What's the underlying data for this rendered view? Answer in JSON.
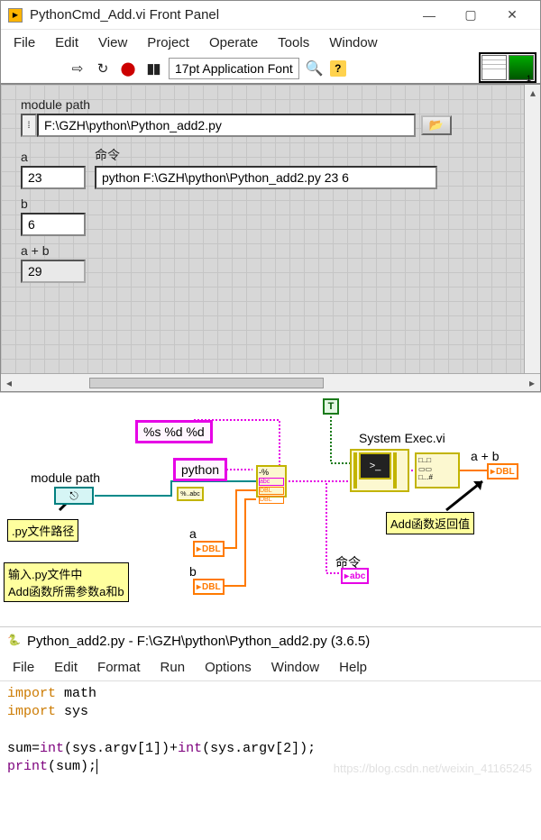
{
  "labview": {
    "window_title": "PythonCmd_Add.vi Front Panel",
    "menubar": [
      "File",
      "Edit",
      "View",
      "Project",
      "Operate",
      "Tools",
      "Window"
    ],
    "font": "17pt Application Font",
    "ctx_num": "1",
    "controls": {
      "module_path_label": "module path",
      "module_path_value": "F:\\GZH\\python\\Python_add2.py",
      "a_label": "a",
      "a_value": "23",
      "cmd_label": "命令",
      "cmd_value": "python F:\\GZH\\python\\Python_add2.py 23 6",
      "b_label": "b",
      "b_value": "6",
      "sum_label": "a + b",
      "sum_value": "29"
    }
  },
  "bd": {
    "format_str": "%s %d %d",
    "python_cmd": "python",
    "module_path_label": "module path",
    "a_label": "a",
    "b_label": "b",
    "cmd_label": "命令",
    "true_const": "T",
    "sysexec_label": "System Exec.vi",
    "sum_label": "a + b",
    "tip_path": ".py文件路径",
    "tip_inputs": "输入.py文件中\nAdd函数所需参数a和b",
    "tip_return": "Add函数返回值",
    "dbl": "DBL",
    "abc": "abc",
    "fis_top": "-%",
    "p2s": "%..abc"
  },
  "idle": {
    "title": "Python_add2.py - F:\\GZH\\python\\Python_add2.py (3.6.5)",
    "menubar": [
      "File",
      "Edit",
      "Format",
      "Run",
      "Options",
      "Window",
      "Help"
    ],
    "code": {
      "l1a": "import",
      "l1b": " math",
      "l2a": "import",
      "l2b": " sys",
      "l4a": "sum=",
      "l4b": "int",
      "l4c": "(sys.argv[1])+",
      "l4d": "int",
      "l4e": "(sys.argv[2]);",
      "l5a": "print",
      "l5b": "(sum);"
    }
  },
  "watermark": "https://blog.csdn.net/weixin_41165245"
}
